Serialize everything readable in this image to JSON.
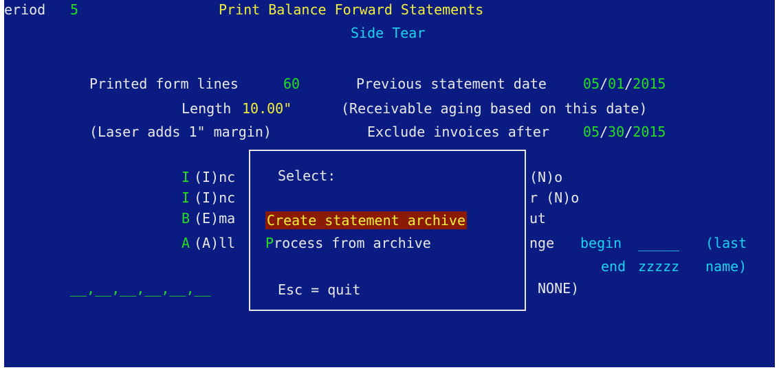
{
  "header": {
    "period_label": "eriod",
    "period_value": "5",
    "title": "Print Balance Forward Statements",
    "subtitle": "Side Tear"
  },
  "settings": {
    "form_lines_label": "Printed form lines",
    "form_lines_value": "60",
    "length_label": "Length",
    "length_value": "10.00\"",
    "laser_note": "(Laser adds 1\" margin)",
    "prev_date_label": "Previous statement date",
    "prev_date_mm": "05",
    "prev_date_dd": "01",
    "prev_date_yyyy": "2015",
    "aging_note": "(Receivable aging based on this date)",
    "exclude_label": "Exclude invoices after",
    "exclude_mm": "05",
    "exclude_dd": "30",
    "exclude_yyyy": "2015",
    "date_sep": "/"
  },
  "options": [
    {
      "value": "I",
      "text": "(I)nc",
      "right": "(N)o"
    },
    {
      "value": "I",
      "text": "(I)nc",
      "right": "r (N)o"
    },
    {
      "value": "B",
      "text": "(E)ma",
      "right": "ut"
    },
    {
      "value": "A",
      "text": "(A)ll",
      "right": "nge"
    }
  ],
  "range": {
    "begin_label": "begin",
    "begin_value": "_____",
    "end_label": "end",
    "end_value": "zzzzz",
    "paren_line1": "(last",
    "paren_line2": "name)"
  },
  "codes": {
    "blanks": "__,__,__,__,__,__",
    "none_text": "NONE)"
  },
  "popup": {
    "title": "Select:",
    "item1": "Create statement archive",
    "item2_hotkey": "P",
    "item2_rest": "rocess from archive",
    "quit": "Esc = quit"
  }
}
